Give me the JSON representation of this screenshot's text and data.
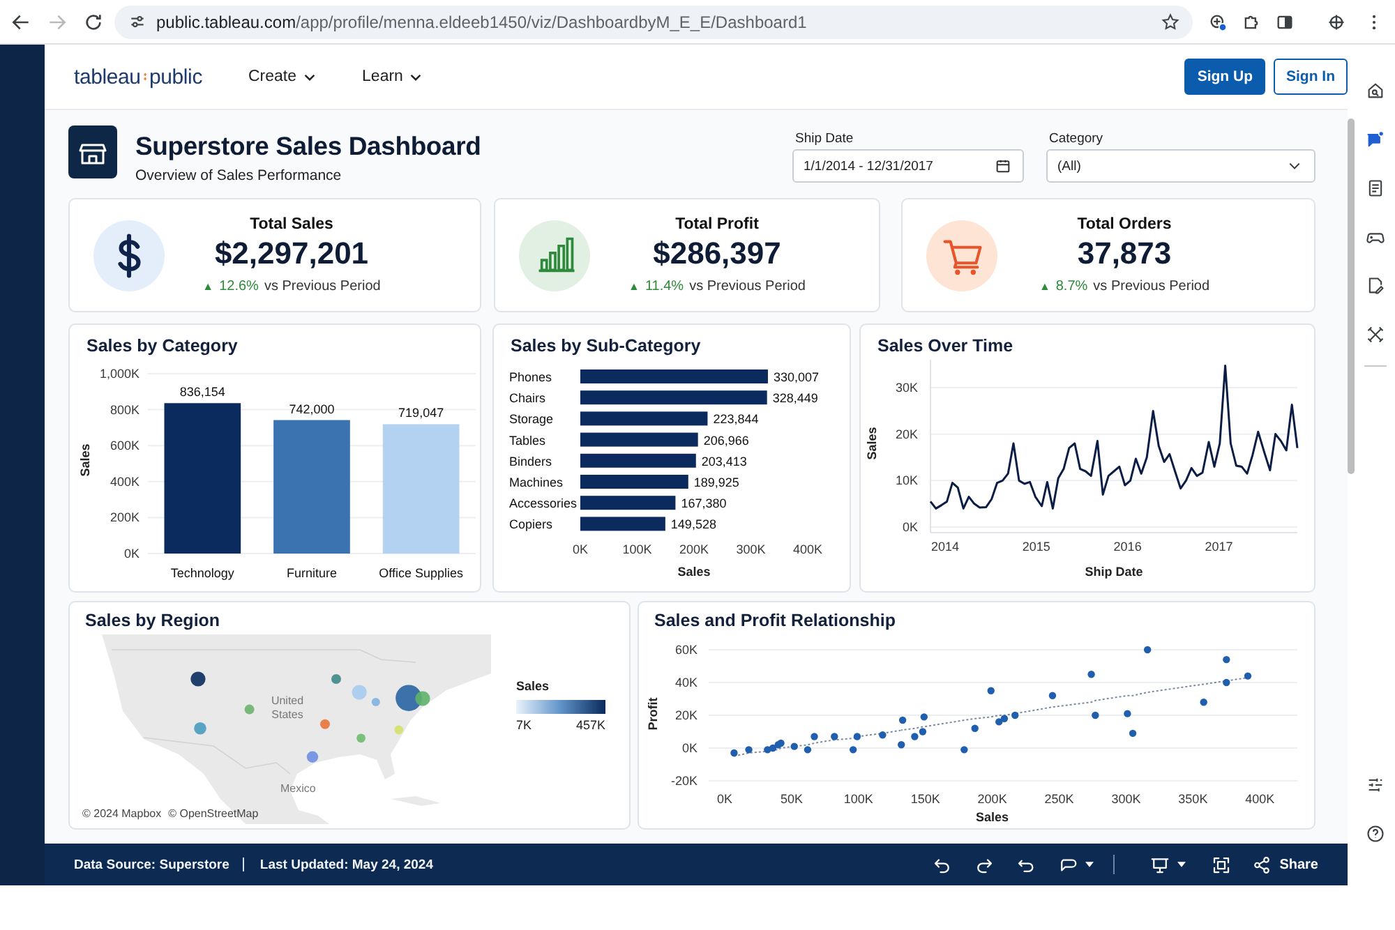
{
  "browser": {
    "url_host": "public.tableau.com",
    "url_path": "/app/profile/menna.eldeeb1450/viz/DashboardbyM_E_E/Dashboard1"
  },
  "site_header": {
    "logo": {
      "brand": "tableau",
      "product": "public"
    },
    "nav": [
      {
        "label": "Create"
      },
      {
        "label": "Learn"
      }
    ],
    "buttons": [
      {
        "label": "Sign Up",
        "kind": "primary"
      },
      {
        "label": "Sign In",
        "kind": "outline"
      }
    ]
  },
  "dashboard": {
    "title": "Superstore Sales Dashboard",
    "subtitle": "Overview of Sales Performance",
    "filters": [
      {
        "kind": "date",
        "label": "Ship Date",
        "value": "1/1/2014 - 12/31/2017"
      },
      {
        "kind": "select",
        "label": "Category",
        "value": "(All)"
      }
    ],
    "kpis": [
      {
        "kind": "money",
        "title": "Total Sales",
        "value": "$2,297,201",
        "arrow": "▲",
        "change": "12.6%",
        "comparison": "vs Previous Period"
      },
      {
        "kind": "growth",
        "title": "Total Profit",
        "value": "$286,397",
        "arrow": "▲",
        "change": "11.4%",
        "comparison": "vs Previous Period"
      },
      {
        "kind": "cart",
        "title": "Total Orders",
        "value": "37,873",
        "arrow": "▲",
        "change": "8.7%",
        "comparison": "vs Previous Period"
      }
    ],
    "sales_by_category": {
      "title": "Sales by Category",
      "chart_data": {
        "type": "bar",
        "ylabel": "Sales",
        "categories": [
          "Technology",
          "Furniture",
          "Office Supplies"
        ],
        "values": [
          836154,
          742000,
          719047
        ],
        "colors": [
          "#0b2b5e",
          "#3b72b0",
          "#b3d2f1"
        ],
        "value_labels": [
          "836,154",
          "742,000",
          "719,047"
        ],
        "grid": true,
        "ylim": [
          0,
          1000000
        ],
        "yticks": [
          {
            "value": 0,
            "label": "0K"
          },
          {
            "value": 200000,
            "label": "200K"
          },
          {
            "value": 400000,
            "label": "400K"
          },
          {
            "value": 600000,
            "label": "600K"
          },
          {
            "value": 800000,
            "label": "800K"
          },
          {
            "value": 1000000,
            "label": "1,000K"
          }
        ]
      }
    },
    "sales_by_sub_category": {
      "title": "Sales by Sub-Category",
      "chart_data": {
        "type": "bar",
        "orientation": "horizontal",
        "xlabel": "Sales",
        "categories": [
          "Phones",
          "Chairs",
          "Storage",
          "Tables",
          "Binders",
          "Machines",
          "Accessories",
          "Copiers"
        ],
        "series": [
          {
            "color": "#0b2b5e",
            "values": [
              330007,
              328449,
              223844,
              206966,
              203413,
              189925,
              167380,
              149528
            ]
          }
        ],
        "value_labels": [
          "330,007",
          "328,449",
          "223,844",
          "206,966",
          "203,413",
          "189,925",
          "167,380",
          "149,528"
        ],
        "xlim": [
          0,
          400000
        ],
        "xticks": [
          {
            "value": 0,
            "label": "0K"
          },
          {
            "value": 100000,
            "label": "100K"
          },
          {
            "value": 200000,
            "label": "200K"
          },
          {
            "value": 300000,
            "label": "300K"
          },
          {
            "value": 400000,
            "label": "400K"
          }
        ]
      }
    },
    "sales_over_time": {
      "title": "Sales Over Time",
      "chart_data": {
        "type": "line",
        "xlabel": "Ship Date",
        "ylabel": "Sales",
        "x": [
          2013.84,
          2013.9,
          2013.96,
          2014.02,
          2014.08,
          2014.14,
          2014.2,
          2014.26,
          2014.32,
          2014.38,
          2014.45,
          2014.51,
          2014.57,
          2014.63,
          2014.69,
          2014.75,
          2014.81,
          2014.87,
          2014.93,
          2014.99,
          2015.06,
          2015.12,
          2015.18,
          2015.24,
          2015.3,
          2015.36,
          2015.42,
          2015.48,
          2015.54,
          2015.6,
          2015.67,
          2015.73,
          2015.79,
          2015.85,
          2015.91,
          2015.97,
          2016.03,
          2016.09,
          2016.15,
          2016.21,
          2016.28,
          2016.34,
          2016.4,
          2016.46,
          2016.52,
          2016.58,
          2016.64,
          2016.7,
          2016.76,
          2016.82,
          2016.89,
          2016.95,
          2017.01,
          2017.07,
          2017.13,
          2017.19,
          2017.25,
          2017.31,
          2017.37,
          2017.43,
          2017.5,
          2017.56,
          2017.62,
          2017.68,
          2017.74,
          2017.8,
          2017.86
        ],
        "series": [
          {
            "color": "#0b1d45",
            "values": [
              5.5,
              4,
              4.7,
              5.5,
              9.5,
              8.5,
              4,
              6.5,
              5,
              4.2,
              4.3,
              6,
              9.5,
              10,
              11.5,
              18,
              10,
              9.3,
              9.7,
              6.5,
              4.5,
              9.7,
              4,
              10.5,
              12.5,
              17,
              18,
              12.5,
              12,
              11,
              18.5,
              7,
              11,
              12,
              13,
              9,
              10,
              14.7,
              11.5,
              15,
              25,
              17.5,
              14,
              15.7,
              12,
              8.3,
              10,
              12.7,
              11,
              11.7,
              18.3,
              13,
              18,
              34.7,
              18,
              13.2,
              13,
              11.5,
              15.5,
              20.5,
              16,
              12.2,
              20,
              18.5,
              16.5,
              26.3,
              17
            ]
          }
        ],
        "grid": true,
        "xlim": [
          2013.84,
          2017.86
        ],
        "xticks": [
          2014,
          2015,
          2016,
          2017
        ],
        "ylim": [
          -1.2,
          36
        ],
        "yticks": [
          {
            "value": 0,
            "label": "0K"
          },
          {
            "value": 10,
            "label": "10K"
          },
          {
            "value": 20,
            "label": "20K"
          },
          {
            "value": 30,
            "label": "30K"
          }
        ]
      }
    },
    "sales_by_region": {
      "title": "Sales by Region",
      "labels": [
        "United States",
        "Mexico"
      ],
      "legend": {
        "title": "Sales",
        "min": "7K",
        "max": "457K"
      },
      "attribution": [
        "© 2024 Mapbox",
        "© OpenStreetMap"
      ]
    },
    "sales_and_profit": {
      "title": "Sales and Profit Relationship",
      "chart_data": {
        "type": "scatter",
        "xlabel": "Sales",
        "ylabel": "Profit",
        "x": [
          7,
          18,
          32,
          36,
          40,
          42,
          52,
          62,
          67,
          82,
          96,
          99,
          118,
          133,
          132,
          142,
          148,
          149,
          179,
          187,
          199,
          205,
          209,
          217,
          245,
          274,
          277,
          301,
          305,
          316,
          358,
          375,
          375,
          391
        ],
        "series": [
          {
            "color": "#1f5fae",
            "values": [
              -3,
              -1,
              -1,
              0,
              2,
              3,
              1,
              -1,
              7,
              7,
              -1,
              7,
              8,
              17,
              2,
              7,
              10,
              19,
              -1,
              12,
              35,
              16,
              18,
              20,
              32,
              45,
              20,
              21,
              9,
              60,
              28,
              54,
              40,
              44
            ]
          },
          {
            "type": "line",
            "line_style": "dotted",
            "color": "#7d8ba0",
            "values": [
              -5,
              -3,
              -2,
              -1,
              -1,
              0,
              1,
              2,
              3,
              5,
              6,
              7,
              9,
              11,
              11,
              12,
              13,
              13,
              17,
              18,
              19,
              20,
              20,
              21,
              25,
              28,
              29,
              32,
              32,
              34,
              39,
              41,
              41,
              43
            ]
          }
        ],
        "grid": true,
        "xlim": [
          -12,
          428
        ],
        "ylim": [
          -20,
          60
        ],
        "xticks": [
          {
            "value": 0,
            "label": "0K"
          },
          {
            "value": 50,
            "label": "50K"
          },
          {
            "value": 100,
            "label": "100K"
          },
          {
            "value": 150,
            "label": "150K"
          },
          {
            "value": 200,
            "label": "200K"
          },
          {
            "value": 250,
            "label": "250K"
          },
          {
            "value": 300,
            "label": "300K"
          },
          {
            "value": 350,
            "label": "350K"
          },
          {
            "value": 400,
            "label": "400K"
          }
        ],
        "yticks": [
          {
            "value": -20,
            "label": "-20K"
          },
          {
            "value": 0,
            "label": "0K"
          },
          {
            "value": 20,
            "label": "20K"
          },
          {
            "value": 40,
            "label": "40K"
          },
          {
            "value": 60,
            "label": "60K"
          }
        ]
      }
    }
  },
  "footer": {
    "data_source": "Data Source: Superstore",
    "last_updated": "Last Updated: May 24, 2024",
    "share": "Share"
  }
}
